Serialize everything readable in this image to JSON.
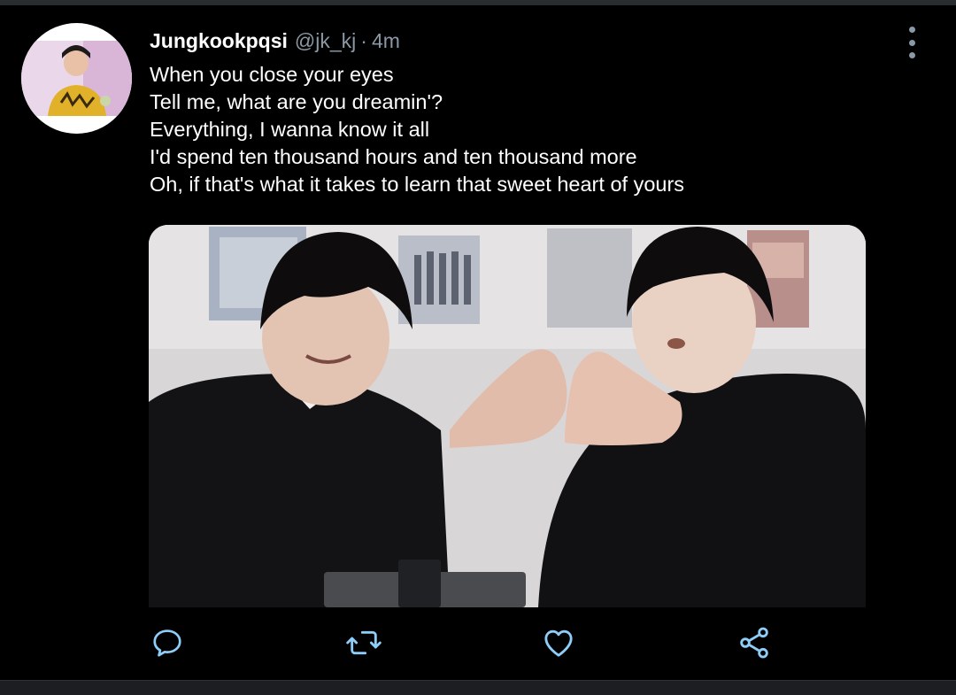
{
  "tweet": {
    "display_name": "Jungkookpqsi",
    "handle": "@jk_kj",
    "separator": "·",
    "time": "4m",
    "lines": [
      "When you close your eyes",
      "Tell me, what are you dreamin'?",
      "Everything, I wanna know it all",
      "I'd spend ten thousand hours and ten thousand more",
      "Oh, if that's what it takes to learn that sweet heart of yours"
    ]
  },
  "icons": {
    "more": "more-vertical-icon",
    "reply": "reply-icon",
    "retweet": "retweet-icon",
    "like": "heart-icon",
    "share": "share-icon"
  },
  "colors": {
    "background": "#000000",
    "text": "#ffffff",
    "secondary_text": "#8b98a5",
    "icon_accent": "#8ecdf8"
  }
}
